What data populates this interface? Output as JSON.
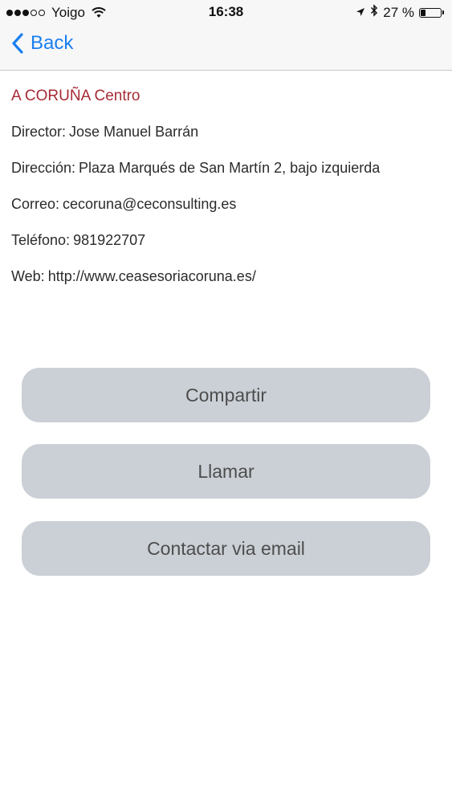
{
  "status_bar": {
    "signal_full": 3,
    "signal_total": 5,
    "carrier": "Yoigo",
    "time": "16:38",
    "battery_percent_text": "27 %",
    "battery_level": 0.27
  },
  "nav": {
    "back_label": "Back",
    "accent_color": "#1a7ff0"
  },
  "office": {
    "name": "A CORUÑA Centro",
    "name_color": "#a62b36",
    "fields": [
      {
        "label": "Director:",
        "value": "Jose Manuel Barrán"
      },
      {
        "label": "Dirección:",
        "value": "Plaza Marqués de San Martín 2, bajo izquierda"
      },
      {
        "label": "Correo:",
        "value": "cecoruna@ceconsulting.es"
      },
      {
        "label": "Teléfono:",
        "value": "981922707"
      },
      {
        "label": "Web:",
        "value": "http://www.ceasesoriacoruna.es/"
      }
    ]
  },
  "actions": {
    "share_label": "Compartir",
    "call_label": "Llamar",
    "email_label": "Contactar via email",
    "button_color": "#cbd0d6"
  }
}
